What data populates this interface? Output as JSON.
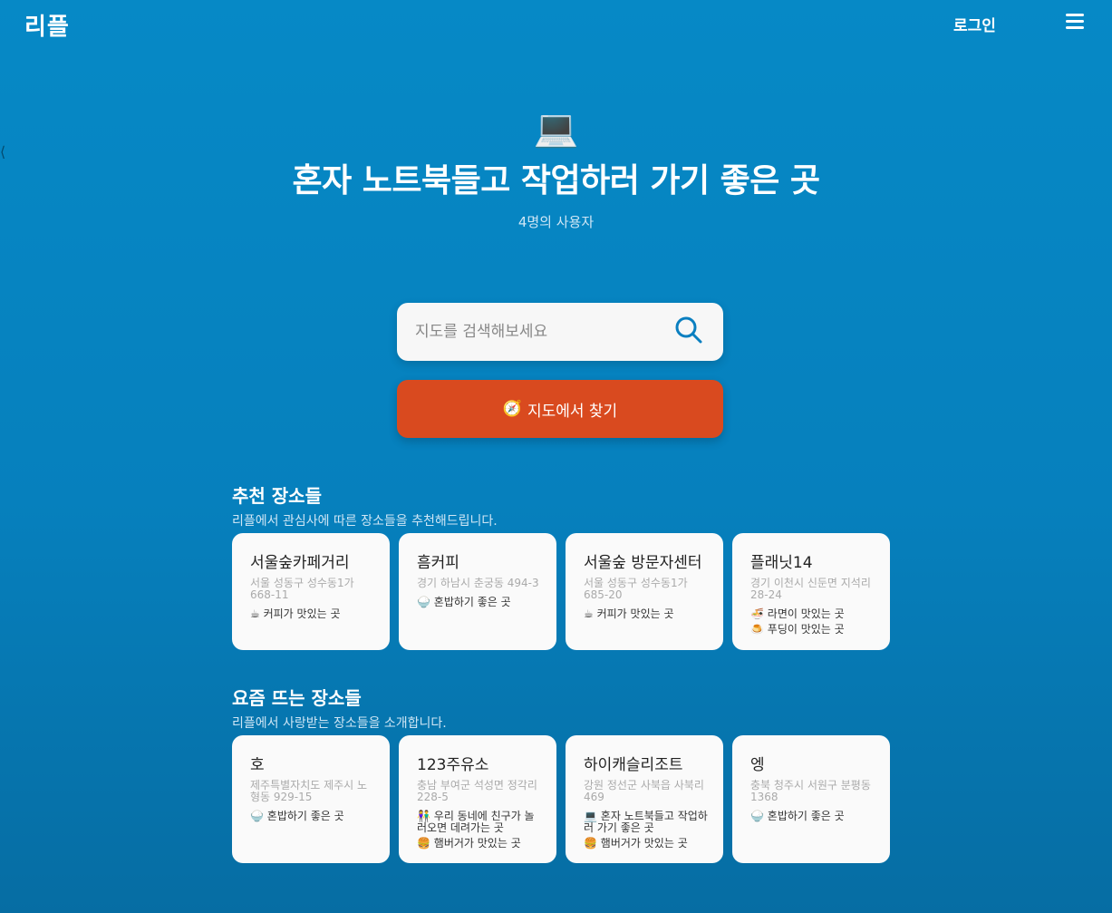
{
  "header": {
    "logo": "리플",
    "login": "로그인"
  },
  "hero": {
    "icon": "💻",
    "title": "혼자 노트북들고 작업하러 가기 좋은 곳",
    "users": "4명의 사용자"
  },
  "search": {
    "placeholder": "지도를 검색해보세요"
  },
  "find_button": {
    "icon": "🧭",
    "label": "지도에서 찾기"
  },
  "recommended": {
    "title": "추천 장소들",
    "desc": "리플에서 관심사에 따른 장소들을 추천해드립니다.",
    "cards": [
      {
        "name": "서울숲카페거리",
        "address": "서울 성동구 성수동1가 668-11",
        "tags": [
          {
            "icon": "☕",
            "text": "커피가 맛있는 곳"
          }
        ]
      },
      {
        "name": "흠커피",
        "address": "경기 하남시 춘궁동 494-3",
        "tags": [
          {
            "icon": "🍚",
            "text": "혼밥하기 좋은 곳"
          }
        ]
      },
      {
        "name": "서울숲 방문자센터",
        "address": "서울 성동구 성수동1가 685-20",
        "tags": [
          {
            "icon": "☕",
            "text": "커피가 맛있는 곳"
          }
        ]
      },
      {
        "name": "플래닛14",
        "address": "경기 이천시 신둔면 지석리 28-24",
        "tags": [
          {
            "icon": "🍜",
            "text": "라면이 맛있는 곳"
          },
          {
            "icon": "🍮",
            "text": "푸딩이 맛있는 곳"
          }
        ]
      }
    ]
  },
  "trending": {
    "title": "요즘 뜨는 장소들",
    "desc": "리플에서 사랑받는 장소들을 소개합니다.",
    "cards": [
      {
        "name": "호",
        "address": "제주특별자치도 제주시 노형동 929-15",
        "tags": [
          {
            "icon": "🍚",
            "text": "혼밥하기 좋은 곳"
          }
        ]
      },
      {
        "name": "123주유소",
        "address": "충남 부여군 석성면 정각리 228-5",
        "tags": [
          {
            "icon": "👫",
            "text": "우리 동네에 친구가 놀러오면 데려가는 곳"
          },
          {
            "icon": "🍔",
            "text": "햄버거가 맛있는 곳"
          }
        ]
      },
      {
        "name": "하이캐슬리조트",
        "address": "강원 정선군 사북읍 사북리 469",
        "tags": [
          {
            "icon": "💻",
            "text": "혼자 노트북들고 작업하러 가기 좋은 곳"
          },
          {
            "icon": "🍔",
            "text": "햄버거가 맛있는 곳"
          }
        ]
      },
      {
        "name": "엥",
        "address": "충북 청주시 서원구 분평동 1368",
        "tags": [
          {
            "icon": "🍚",
            "text": "혼밥하기 좋은 곳"
          }
        ]
      }
    ]
  }
}
